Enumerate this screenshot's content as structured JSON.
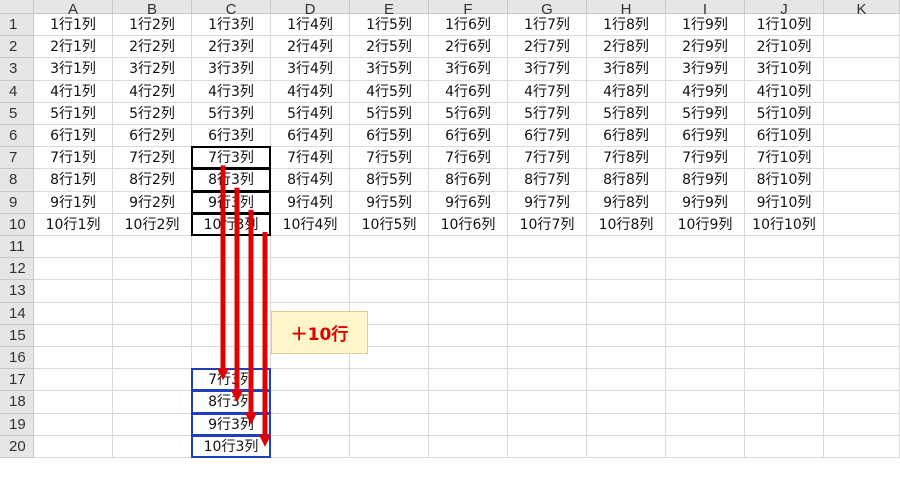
{
  "sheet": {
    "columns": [
      "A",
      "B",
      "C",
      "D",
      "E",
      "F",
      "G",
      "H",
      "I",
      "J",
      "K"
    ],
    "rows": [
      "1",
      "2",
      "3",
      "4",
      "5",
      "6",
      "7",
      "8",
      "9",
      "10",
      "11",
      "12",
      "13",
      "14",
      "15",
      "16",
      "17",
      "18",
      "19",
      "20"
    ],
    "cells": [
      [
        "1行1列",
        "1行2列",
        "1行3列",
        "1行4列",
        "1行5列",
        "1行6列",
        "1行7列",
        "1行8列",
        "1行9列",
        "1行10列",
        ""
      ],
      [
        "2行1列",
        "2行2列",
        "2行3列",
        "2行4列",
        "2行5列",
        "2行6列",
        "2行7列",
        "2行8列",
        "2行9列",
        "2行10列",
        ""
      ],
      [
        "3行1列",
        "3行2列",
        "3行3列",
        "3行4列",
        "3行5列",
        "3行6列",
        "3行7列",
        "3行8列",
        "3行9列",
        "3行10列",
        ""
      ],
      [
        "4行1列",
        "4行2列",
        "4行3列",
        "4行4列",
        "4行5列",
        "4行6列",
        "4行7列",
        "4行8列",
        "4行9列",
        "4行10列",
        ""
      ],
      [
        "5行1列",
        "5行2列",
        "5行3列",
        "5行4列",
        "5行5列",
        "5行6列",
        "5行7列",
        "5行8列",
        "5行9列",
        "5行10列",
        ""
      ],
      [
        "6行1列",
        "6行2列",
        "6行3列",
        "6行4列",
        "6行5列",
        "6行6列",
        "6行7列",
        "6行8列",
        "6行9列",
        "6行10列",
        ""
      ],
      [
        "7行1列",
        "7行2列",
        "7行3列",
        "7行4列",
        "7行5列",
        "7行6列",
        "7行7列",
        "7行8列",
        "7行9列",
        "7行10列",
        ""
      ],
      [
        "8行1列",
        "8行2列",
        "8行3列",
        "8行4列",
        "8行5列",
        "8行6列",
        "8行7列",
        "8行8列",
        "8行9列",
        "8行10列",
        ""
      ],
      [
        "9行1列",
        "9行2列",
        "9行3列",
        "9行4列",
        "9行5列",
        "9行6列",
        "9行7列",
        "9行8列",
        "9行9列",
        "9行10列",
        ""
      ],
      [
        "10行1列",
        "10行2列",
        "10行3列",
        "10行4列",
        "10行5列",
        "10行6列",
        "10行7列",
        "10行8列",
        "10行9列",
        "10行10列",
        ""
      ],
      [
        "",
        "",
        "",
        "",
        "",
        "",
        "",
        "",
        "",
        "",
        ""
      ],
      [
        "",
        "",
        "",
        "",
        "",
        "",
        "",
        "",
        "",
        "",
        ""
      ],
      [
        "",
        "",
        "",
        "",
        "",
        "",
        "",
        "",
        "",
        "",
        ""
      ],
      [
        "",
        "",
        "",
        "",
        "",
        "",
        "",
        "",
        "",
        "",
        ""
      ],
      [
        "",
        "",
        "",
        "",
        "",
        "",
        "",
        "",
        "",
        "",
        ""
      ],
      [
        "",
        "",
        "",
        "",
        "",
        "",
        "",
        "",
        "",
        "",
        ""
      ],
      [
        "",
        "",
        "7行3列",
        "",
        "",
        "",
        "",
        "",
        "",
        "",
        ""
      ],
      [
        "",
        "",
        "8行3列",
        "",
        "",
        "",
        "",
        "",
        "",
        "",
        ""
      ],
      [
        "",
        "",
        "9行3列",
        "",
        "",
        "",
        "",
        "",
        "",
        "",
        ""
      ],
      [
        "",
        "",
        "10行3列",
        "",
        "",
        "",
        "",
        "",
        "",
        "",
        ""
      ]
    ]
  },
  "annotation": {
    "label": "＋10行",
    "color": "#e00000"
  },
  "highlight": {
    "source_range": "C7:C10",
    "target_range": "C17:C20",
    "source_color": "#000000",
    "target_color": "#1f3fbf",
    "arrow_color": "#e00000"
  }
}
